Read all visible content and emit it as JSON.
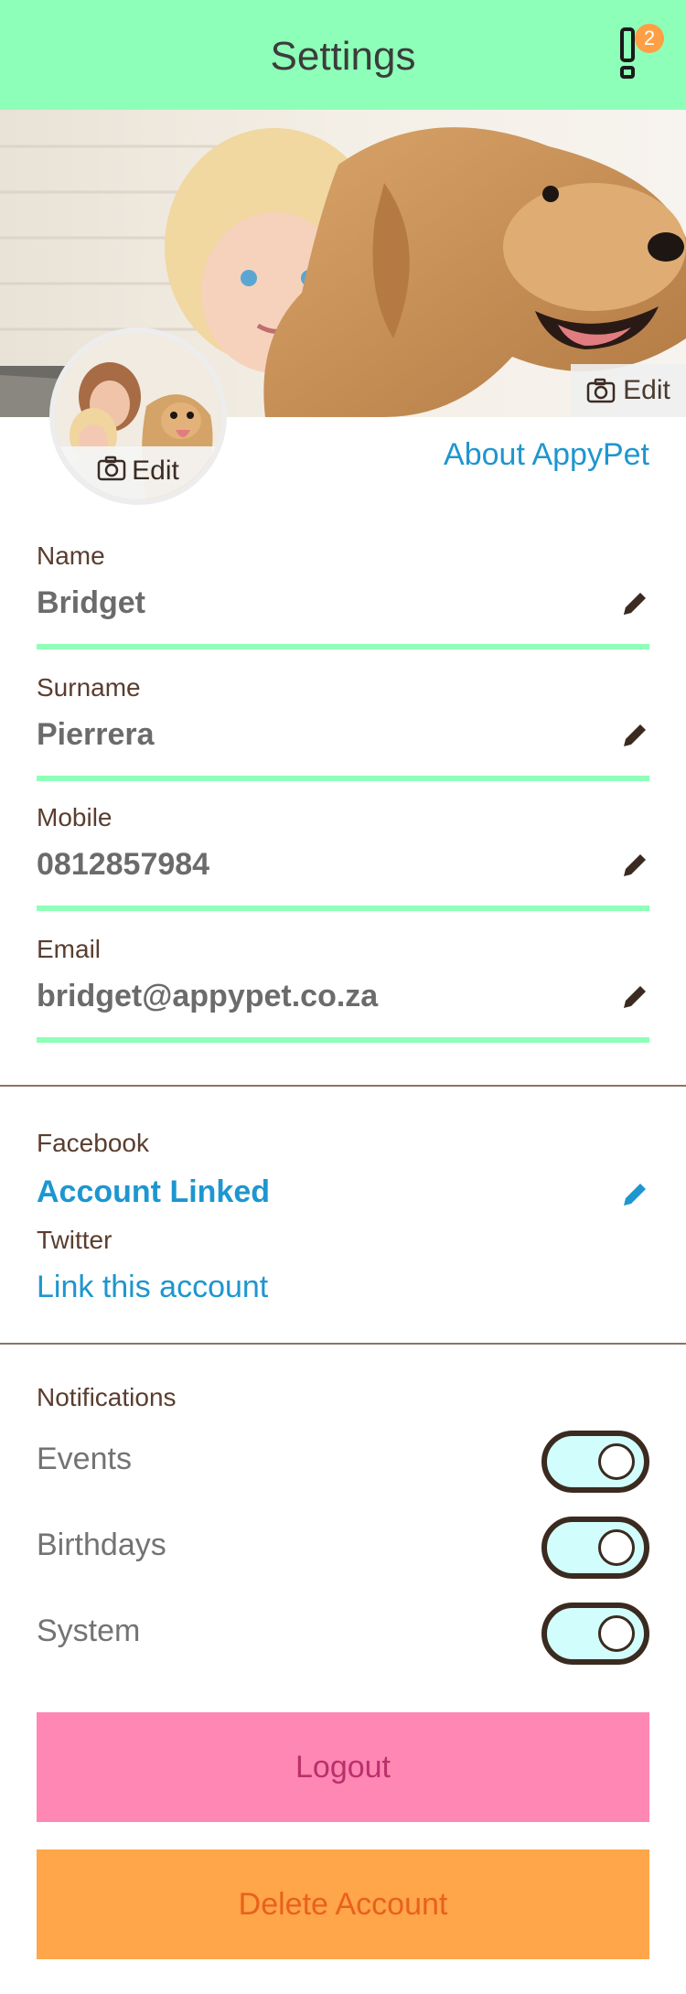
{
  "header": {
    "title": "Settings",
    "notification_count": "2"
  },
  "cover": {
    "edit_label": "Edit"
  },
  "avatar": {
    "edit_label": "Edit"
  },
  "about_link": "About AppyPet",
  "fields": [
    {
      "label": "Name",
      "value": "Bridget"
    },
    {
      "label": "Surname",
      "value": "Pierrera"
    },
    {
      "label": "Mobile",
      "value": "0812857984"
    },
    {
      "label": "Email",
      "value": "bridget@appypet.co.za"
    }
  ],
  "social": {
    "facebook_label": "Facebook",
    "facebook_status": "Account Linked",
    "twitter_label": "Twitter",
    "twitter_action": "Link this account"
  },
  "notifications": {
    "title": "Notifications",
    "items": [
      {
        "label": "Events",
        "enabled": true
      },
      {
        "label": "Birthdays",
        "enabled": true
      },
      {
        "label": "System",
        "enabled": true
      }
    ]
  },
  "buttons": {
    "logout": "Logout",
    "delete": "Delete Account"
  },
  "colors": {
    "accent_green": "#8effb8",
    "link_blue": "#1e96cf",
    "logout_pink": "#ff87b3",
    "delete_orange": "#ffa54a",
    "badge_orange": "#ff9f45"
  },
  "icons": {
    "notification": "exclamation-icon",
    "camera": "camera-icon",
    "edit": "pencil-icon"
  }
}
